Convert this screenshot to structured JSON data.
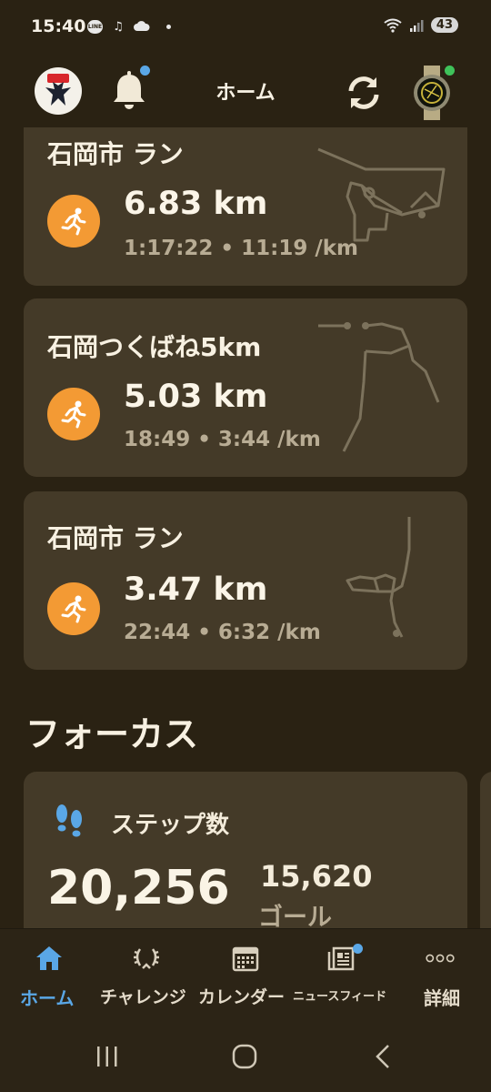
{
  "status_bar": {
    "time": "15:40",
    "line_icon_text": "LINE",
    "battery": "43"
  },
  "header": {
    "title": "ホーム"
  },
  "activities": [
    {
      "name": "石岡市 ラン",
      "distance": "6.83 km",
      "summary": "1:17:22 • 11:19 /km"
    },
    {
      "name": "石岡つくばね5km",
      "distance": "5.03 km",
      "summary": "18:49 • 3:44 /km"
    },
    {
      "name": "石岡市 ラン",
      "distance": "3.47 km",
      "summary": "22:44 • 6:32 /km"
    }
  ],
  "focus": {
    "title": "フォーカス",
    "steps": {
      "label": "ステップ数",
      "value": "20,256",
      "goal_value": "15,620",
      "goal_label": "ゴール"
    }
  },
  "bottom_nav": {
    "items": [
      {
        "label": "ホーム",
        "icon": "home-icon",
        "active": true
      },
      {
        "label": "チャレンジ",
        "icon": "laurel-icon",
        "active": false
      },
      {
        "label": "カレンダー",
        "icon": "calendar-icon",
        "active": false
      },
      {
        "label": "ニュースフィード",
        "icon": "newsfeed-icon",
        "active": false
      },
      {
        "label": "詳細",
        "icon": "more-icon",
        "active": false
      }
    ]
  },
  "colors": {
    "background": "#2a2213",
    "card": "#443a28",
    "accent_orange": "#f39a34",
    "active_blue": "#5aa7e6",
    "online_green": "#3fc25a"
  }
}
